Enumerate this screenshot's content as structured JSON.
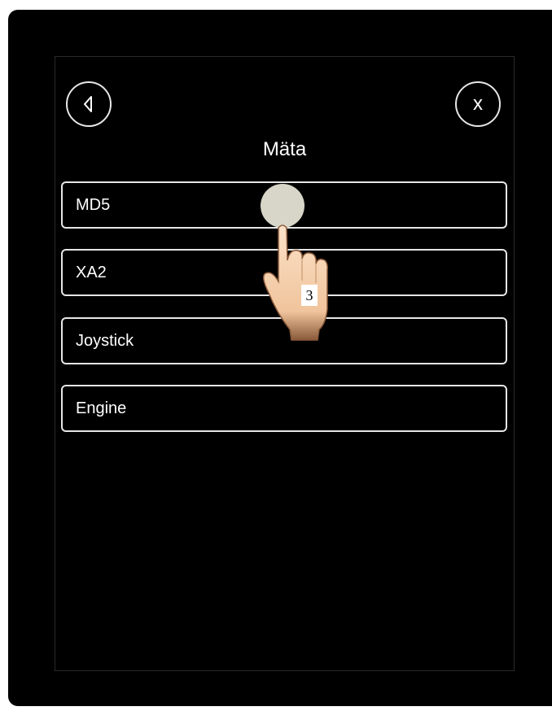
{
  "header": {
    "title": "Mäta",
    "back_icon": "back-arrow-icon",
    "close_icon": "close-icon",
    "close_glyph": "x"
  },
  "menu": {
    "items": [
      {
        "label": "MD5"
      },
      {
        "label": "XA2"
      },
      {
        "label": "Joystick"
      },
      {
        "label": "Engine"
      }
    ]
  },
  "overlay": {
    "icon": "tap-hand-icon",
    "step_number": "3"
  },
  "colors": {
    "background": "#000000",
    "border": "#e6e6e6",
    "text": "#ffffff",
    "tap_indicator": "#d8d6c8"
  }
}
